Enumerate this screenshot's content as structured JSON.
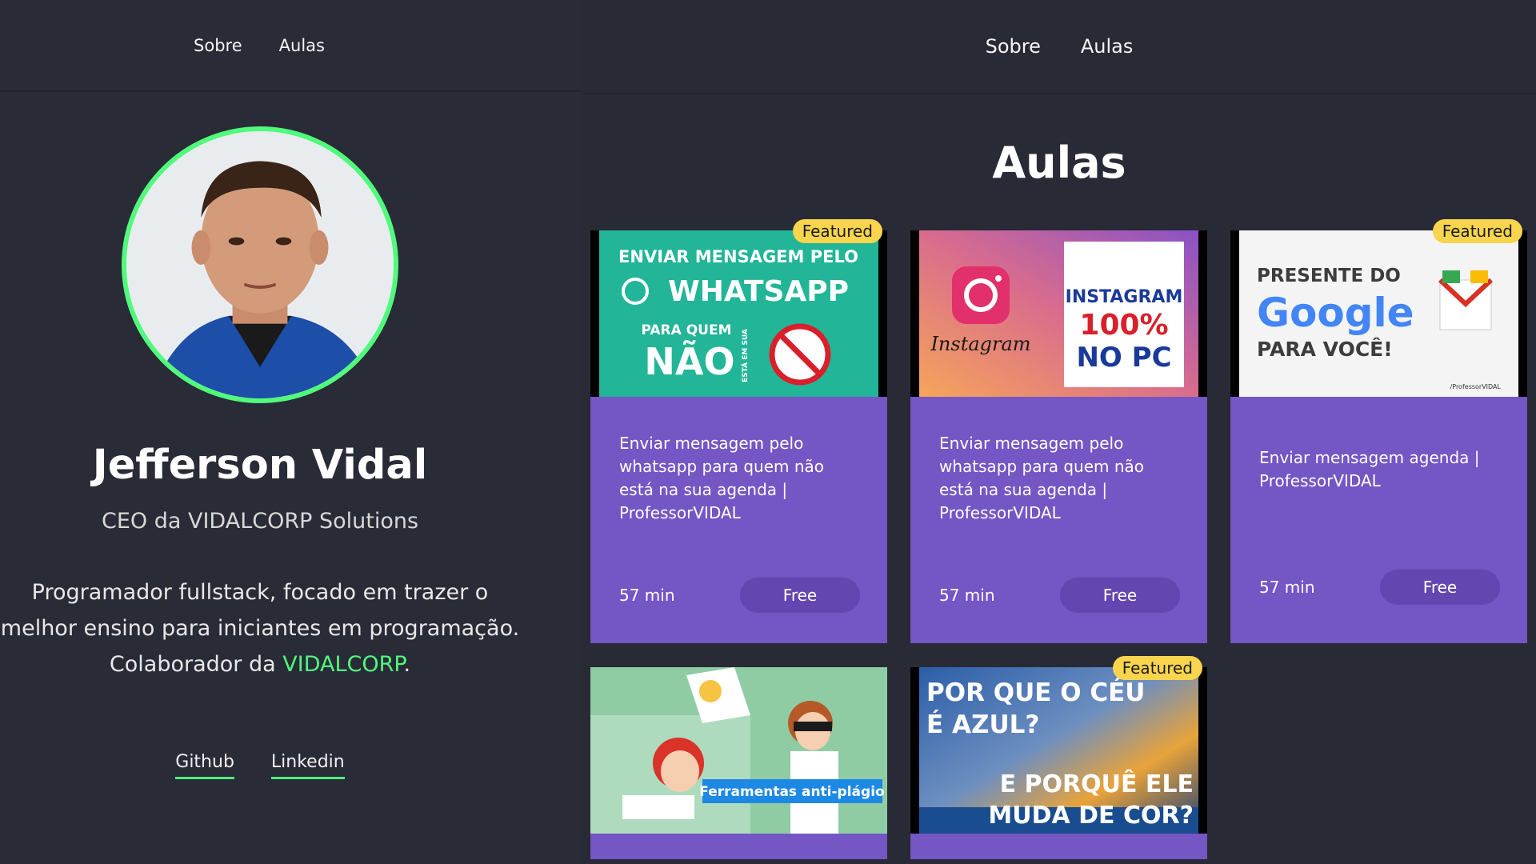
{
  "left_nav": {
    "about": "Sobre",
    "classes": "Aulas"
  },
  "right_nav": {
    "about": "Sobre",
    "classes": "Aulas"
  },
  "profile": {
    "name": "Jefferson Vidal",
    "role": "CEO da VIDALCORP Solutions",
    "bio_line1": "Programador fullstack, focado em trazer o",
    "bio_line2": "melhor ensino para iniciantes em programação.",
    "bio_line3_prefix": "Colaborador da ",
    "bio_link": "VIDALCORP",
    "bio_line3_suffix": ".",
    "github": "Github",
    "linkedin": "Linkedin"
  },
  "section": {
    "title": "Aulas"
  },
  "cards": [
    {
      "badge": "Featured",
      "title": "Enviar mensagem pelo whatsapp para quem não está na sua agenda | ProfessorVIDAL",
      "duration": "57 min",
      "price": "Free",
      "thumb": {
        "line1": "ENVIAR MENSAGEM PELO",
        "line2": "WHATSAPP",
        "line3": "PARA QUEM",
        "line4": "NÃO",
        "side": "ESTÁ EM SUA"
      }
    },
    {
      "badge": "",
      "title": "Enviar mensagem pelo whatsapp para quem não está na sua agenda | ProfessorVIDAL",
      "duration": "57 min",
      "price": "Free",
      "thumb": {
        "brand": "Instagram",
        "line1": "INSTAGRAM",
        "line2": "100%",
        "line3": "NO PC"
      }
    },
    {
      "badge": "Featured",
      "title": "Enviar mensagem agenda | ProfessorVIDAL",
      "duration": "57 min",
      "price": "Free",
      "thumb": {
        "line1": "PRESENTE DO",
        "line2": "Google",
        "line3": "PARA VOCÊ!",
        "credit": "/ProfessorVIDAL"
      }
    },
    {
      "badge": "",
      "thumb": {
        "label": "Ferramentas anti-plágio"
      }
    },
    {
      "badge": "Featured",
      "thumb": {
        "line1": "POR QUE O CÉU",
        "line2": "É AZUL?",
        "line3": "E PORQUÊ ELE",
        "line4": "MUDA DE COR?"
      }
    }
  ],
  "colors": {
    "background": "#282a36",
    "accent_green": "#50fa7b",
    "card_purple": "#7456c4",
    "button_purple": "#6446b0",
    "badge_yellow": "#f9d44d"
  }
}
